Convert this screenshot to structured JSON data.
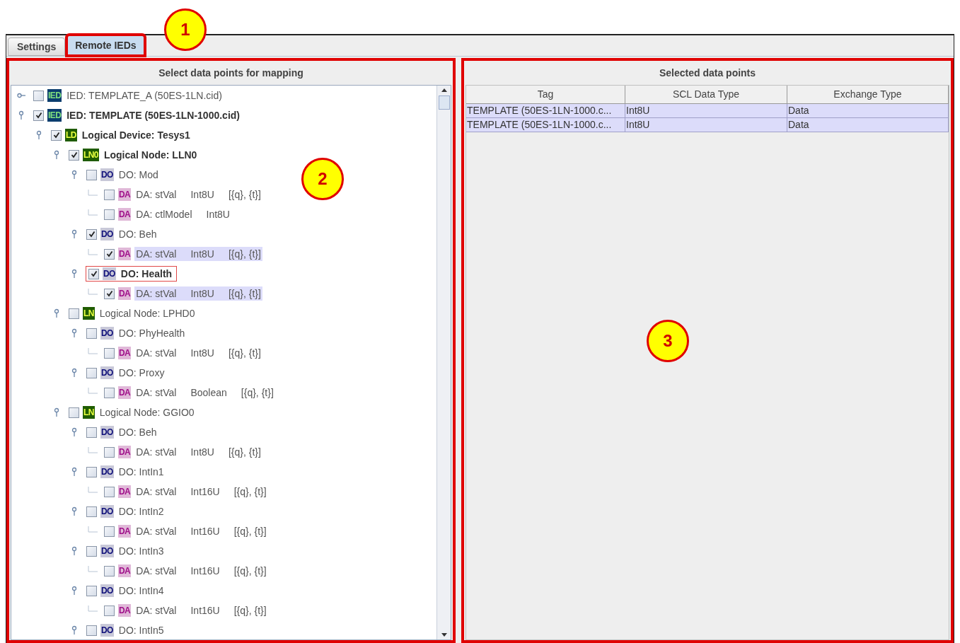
{
  "tabs": [
    {
      "label": "Settings",
      "selected": false,
      "outlined": false
    },
    {
      "label": "Remote IEDs",
      "selected": true,
      "outlined": true
    }
  ],
  "left_panel": {
    "title": "Select data points for mapping",
    "tree": [
      {
        "kind": "ied",
        "badge": "IED",
        "label": "IED: TEMPLATE_A (50ES-1LN.cid)",
        "checked": false,
        "expanded": false
      },
      {
        "kind": "ied",
        "badge": "IED",
        "label": "IED: TEMPLATE (50ES-1LN-1000.cid)",
        "checked": true,
        "expanded": true,
        "children": [
          {
            "kind": "ld",
            "badge": "LD",
            "label": "Logical Device: Tesys1",
            "checked": true,
            "expanded": true,
            "children": [
              {
                "kind": "ln",
                "badge": "LN0",
                "label": "Logical Node: LLN0",
                "checked": true,
                "expanded": true,
                "children": [
                  {
                    "kind": "do",
                    "badge": "DO",
                    "label": "DO: Mod",
                    "checked": false,
                    "expanded": true,
                    "children": [
                      {
                        "kind": "da",
                        "badge": "DA",
                        "label": "DA: stVal",
                        "type": "Int8U",
                        "extra": "[{q}, {t}]",
                        "checked": false
                      },
                      {
                        "kind": "da",
                        "badge": "DA",
                        "label": "DA: ctlModel",
                        "type": "Int8U",
                        "checked": false
                      }
                    ]
                  },
                  {
                    "kind": "do",
                    "badge": "DO",
                    "label": "DO: Beh",
                    "checked": true,
                    "expanded": true,
                    "children": [
                      {
                        "kind": "da",
                        "badge": "DA",
                        "label": "DA: stVal",
                        "type": "Int8U",
                        "extra": "[{q}, {t}]",
                        "checked": true
                      }
                    ]
                  },
                  {
                    "kind": "do",
                    "badge": "DO",
                    "label": "DO: Health",
                    "checked": true,
                    "expanded": true,
                    "outlined": true,
                    "children": [
                      {
                        "kind": "da",
                        "badge": "DA",
                        "label": "DA: stVal",
                        "type": "Int8U",
                        "extra": "[{q}, {t}]",
                        "checked": true
                      }
                    ]
                  }
                ]
              },
              {
                "kind": "ln",
                "badge": "LN",
                "label": "Logical Node: LPHD0",
                "checked": false,
                "expanded": true,
                "children": [
                  {
                    "kind": "do",
                    "badge": "DO",
                    "label": "DO: PhyHealth",
                    "checked": false,
                    "expanded": true,
                    "children": [
                      {
                        "kind": "da",
                        "badge": "DA",
                        "label": "DA: stVal",
                        "type": "Int8U",
                        "extra": "[{q}, {t}]",
                        "checked": false
                      }
                    ]
                  },
                  {
                    "kind": "do",
                    "badge": "DO",
                    "label": "DO: Proxy",
                    "checked": false,
                    "expanded": true,
                    "children": [
                      {
                        "kind": "da",
                        "badge": "DA",
                        "label": "DA: stVal",
                        "type": "Boolean",
                        "extra": "[{q}, {t}]",
                        "checked": false
                      }
                    ]
                  }
                ]
              },
              {
                "kind": "ln",
                "badge": "LN",
                "label": "Logical Node: GGIO0",
                "checked": false,
                "expanded": true,
                "children": [
                  {
                    "kind": "do",
                    "badge": "DO",
                    "label": "DO: Beh",
                    "checked": false,
                    "expanded": true,
                    "children": [
                      {
                        "kind": "da",
                        "badge": "DA",
                        "label": "DA: stVal",
                        "type": "Int8U",
                        "extra": "[{q}, {t}]",
                        "checked": false
                      }
                    ]
                  },
                  {
                    "kind": "do",
                    "badge": "DO",
                    "label": "DO: IntIn1",
                    "checked": false,
                    "expanded": true,
                    "children": [
                      {
                        "kind": "da",
                        "badge": "DA",
                        "label": "DA: stVal",
                        "type": "Int16U",
                        "extra": "[{q}, {t}]",
                        "checked": false
                      }
                    ]
                  },
                  {
                    "kind": "do",
                    "badge": "DO",
                    "label": "DO: IntIn2",
                    "checked": false,
                    "expanded": true,
                    "children": [
                      {
                        "kind": "da",
                        "badge": "DA",
                        "label": "DA: stVal",
                        "type": "Int16U",
                        "extra": "[{q}, {t}]",
                        "checked": false
                      }
                    ]
                  },
                  {
                    "kind": "do",
                    "badge": "DO",
                    "label": "DO: IntIn3",
                    "checked": false,
                    "expanded": true,
                    "children": [
                      {
                        "kind": "da",
                        "badge": "DA",
                        "label": "DA: stVal",
                        "type": "Int16U",
                        "extra": "[{q}, {t}]",
                        "checked": false
                      }
                    ]
                  },
                  {
                    "kind": "do",
                    "badge": "DO",
                    "label": "DO: IntIn4",
                    "checked": false,
                    "expanded": true,
                    "children": [
                      {
                        "kind": "da",
                        "badge": "DA",
                        "label": "DA: stVal",
                        "type": "Int16U",
                        "extra": "[{q}, {t}]",
                        "checked": false
                      }
                    ]
                  },
                  {
                    "kind": "do",
                    "badge": "DO",
                    "label": "DO: IntIn5",
                    "checked": false,
                    "expanded": true
                  }
                ]
              }
            ]
          }
        ]
      }
    ]
  },
  "right_panel": {
    "title": "Selected data points",
    "table": {
      "columns": [
        "Tag",
        "SCL Data Type",
        "Exchange Type"
      ],
      "rows": [
        [
          "TEMPLATE (50ES-1LN-1000.c...",
          "Int8U",
          "Data"
        ],
        [
          "TEMPLATE (50ES-1LN-1000.c...",
          "Int8U",
          "Data"
        ]
      ]
    }
  },
  "callouts": [
    {
      "number": "1"
    },
    {
      "number": "2"
    },
    {
      "number": "3"
    }
  ]
}
